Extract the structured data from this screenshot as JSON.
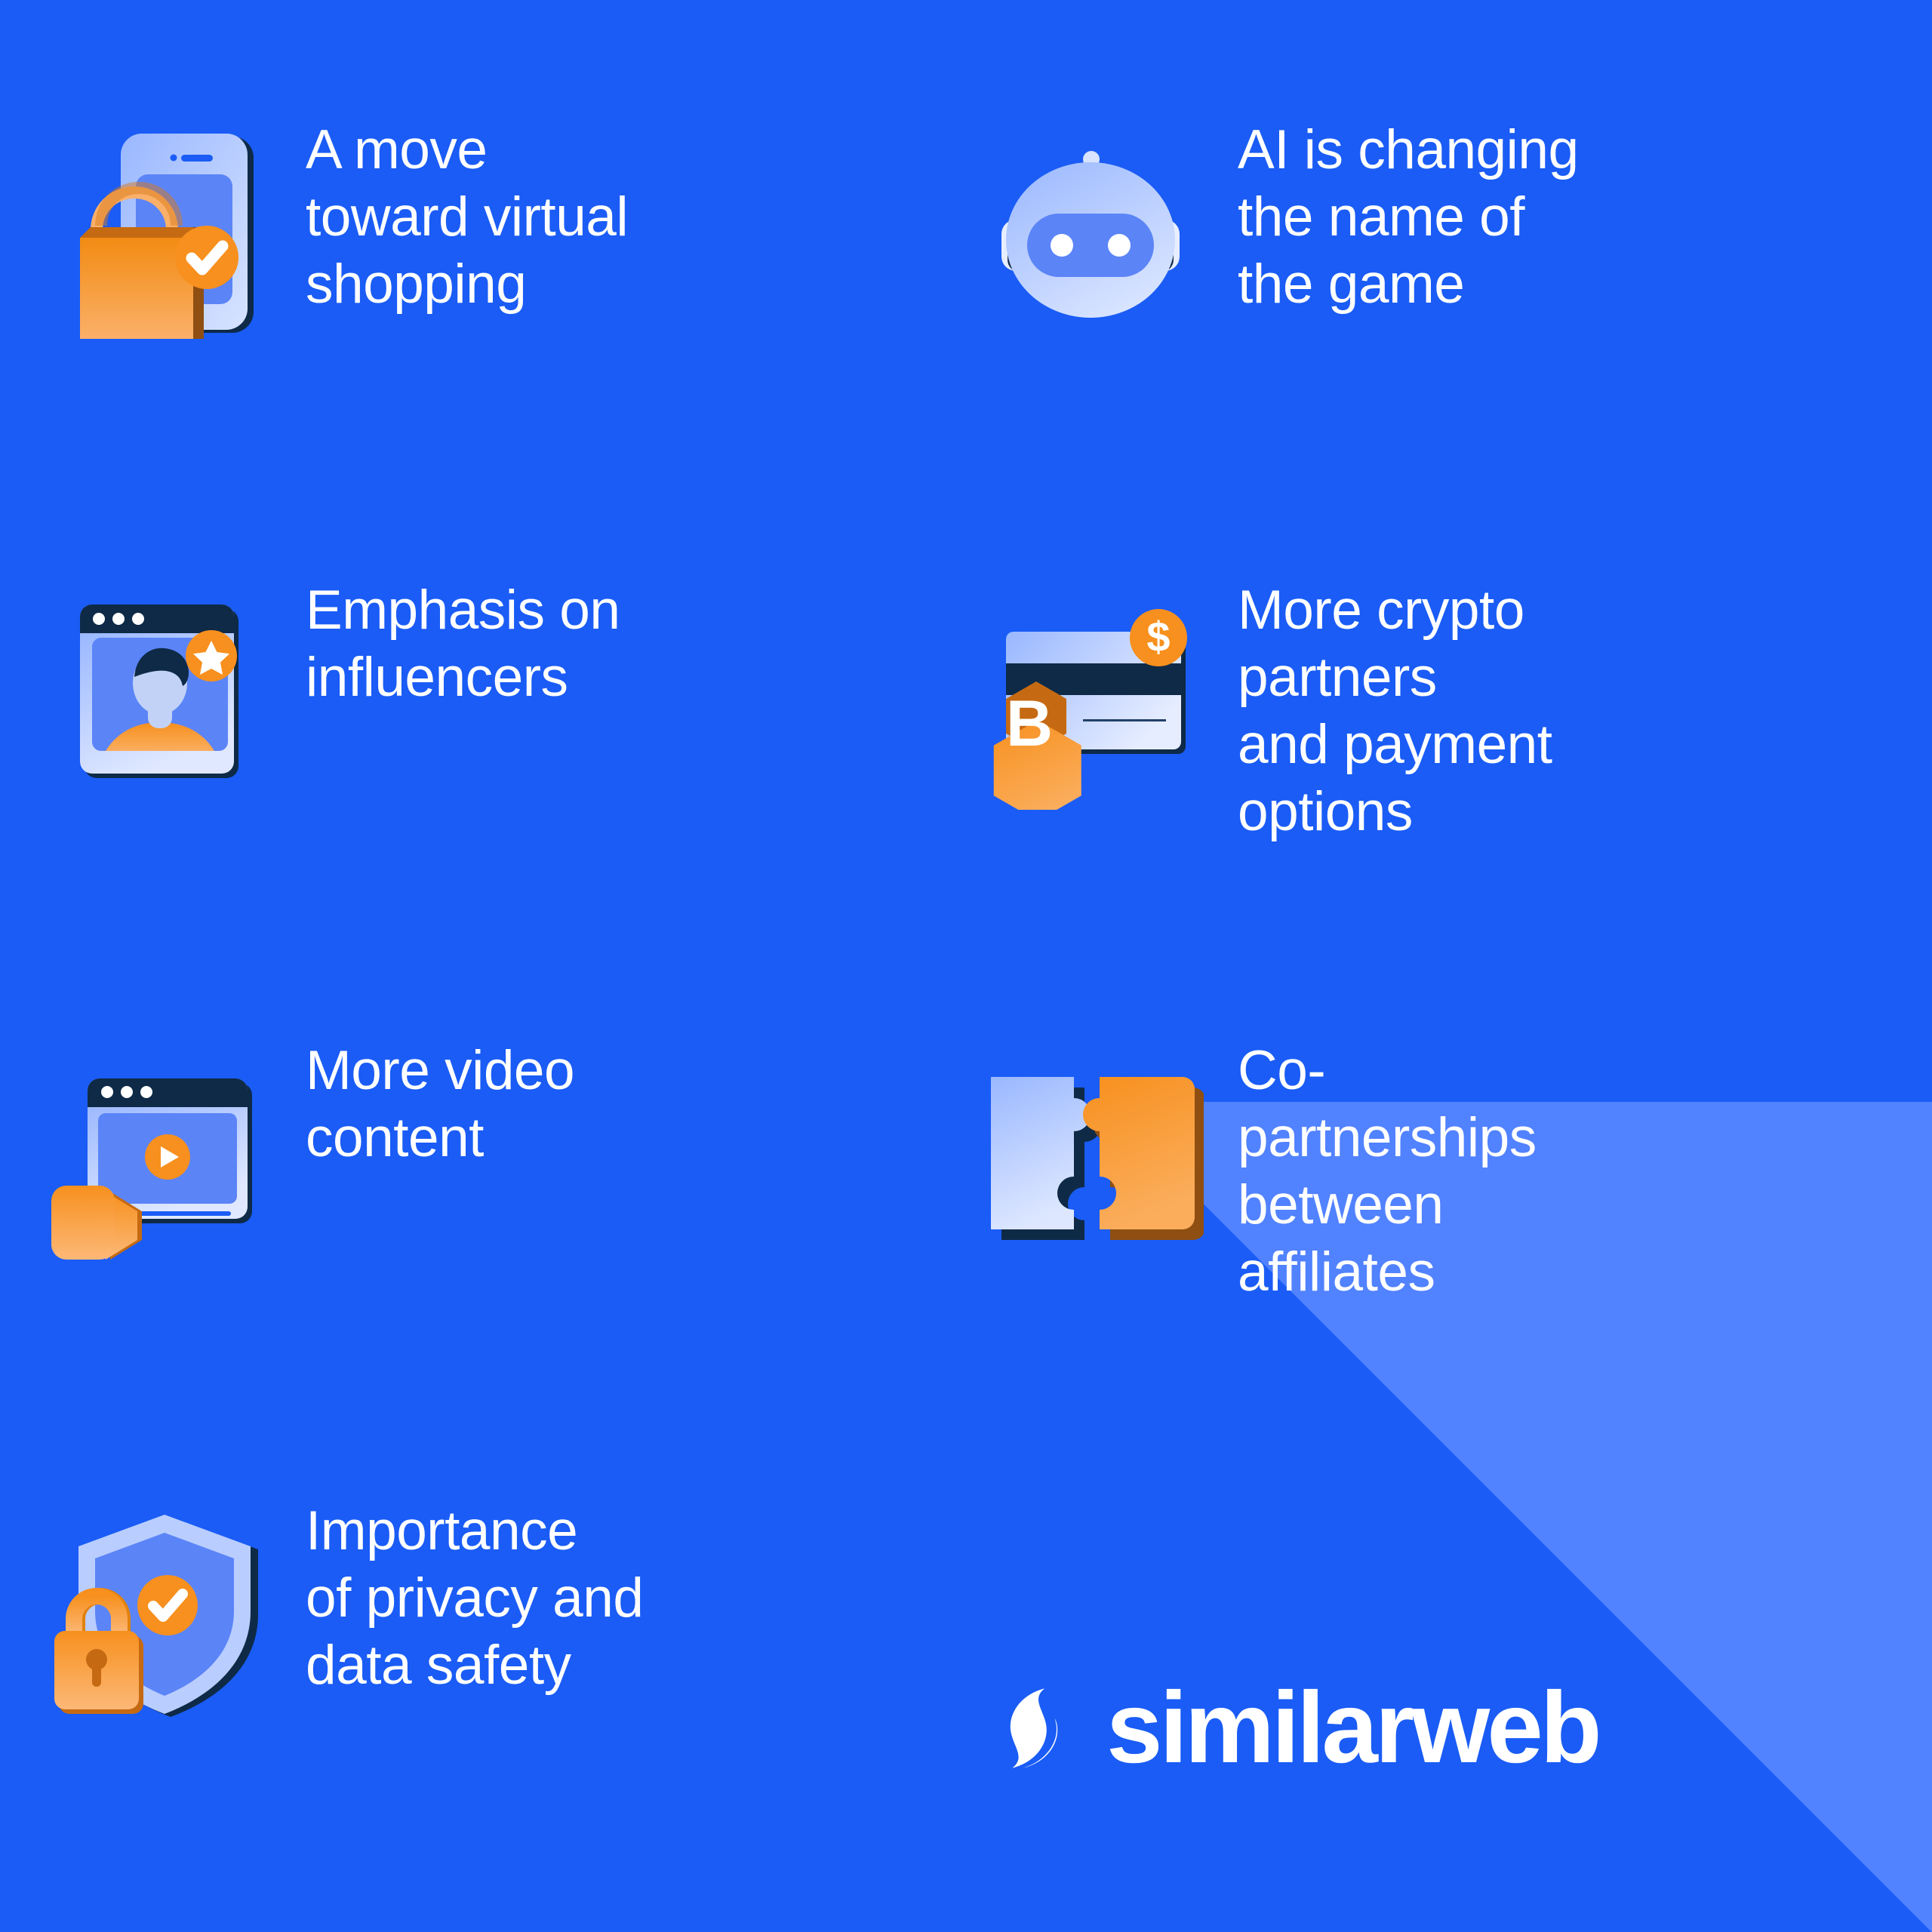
{
  "colors": {
    "background": "#1a5cf5",
    "corner_accent": "#5182ff",
    "orange": "#f7901e",
    "orange_light": "#faa94f",
    "orange_dark": "#8f4f12",
    "navy": "#0e2a47",
    "blue_light": "#8fb0ff",
    "blue_mid": "#5b84f7",
    "white": "#ffffff"
  },
  "items": [
    {
      "icon": "shopping-bag-phone-icon",
      "label": "A move\ntoward virtual\nshopping"
    },
    {
      "icon": "robot-icon",
      "label": "AI is changing\nthe name of\nthe game"
    },
    {
      "icon": "influencer-window-icon",
      "label": "Emphasis on\ninfluencers"
    },
    {
      "icon": "crypto-credit-card-icon",
      "label": "More crypto\npartners\nand payment\noptions"
    },
    {
      "icon": "video-window-icon",
      "label": "More video\ncontent"
    },
    {
      "icon": "puzzle-pieces-icon",
      "label": "Co-\npartnerships\nbetween\naffiliates"
    },
    {
      "icon": "shield-lock-icon",
      "label": "Importance\nof privacy and\ndata safety"
    }
  ],
  "brand": {
    "logo_mark": "similarweb-s-mark-icon",
    "logo_text": "similarweb"
  }
}
